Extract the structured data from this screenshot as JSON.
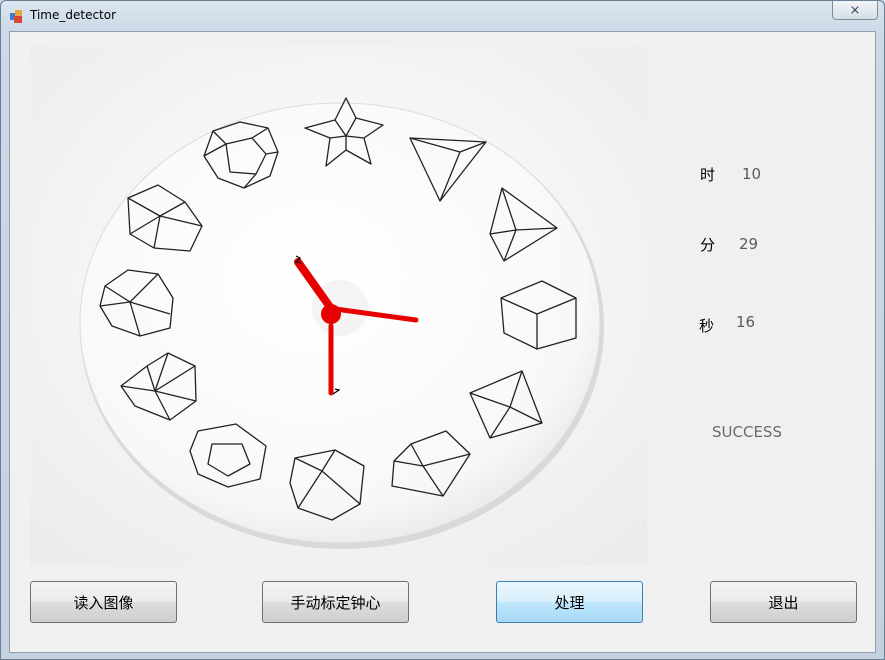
{
  "window": {
    "title": "Time_detector",
    "close_glyph": "⨯"
  },
  "results": {
    "hour_label": "时",
    "hour_value": "10",
    "minute_label": "分",
    "minute_value": "29",
    "second_label": "秒",
    "second_value": "16",
    "status": "SUCCESS"
  },
  "buttons": {
    "load_image": "读入图像",
    "calibrate_center": "手动标定钟心",
    "process": "处理",
    "exit": "退出"
  },
  "colors": {
    "hands": "#e60000",
    "face": "#fafafa",
    "accent": "#3c7fb1"
  }
}
